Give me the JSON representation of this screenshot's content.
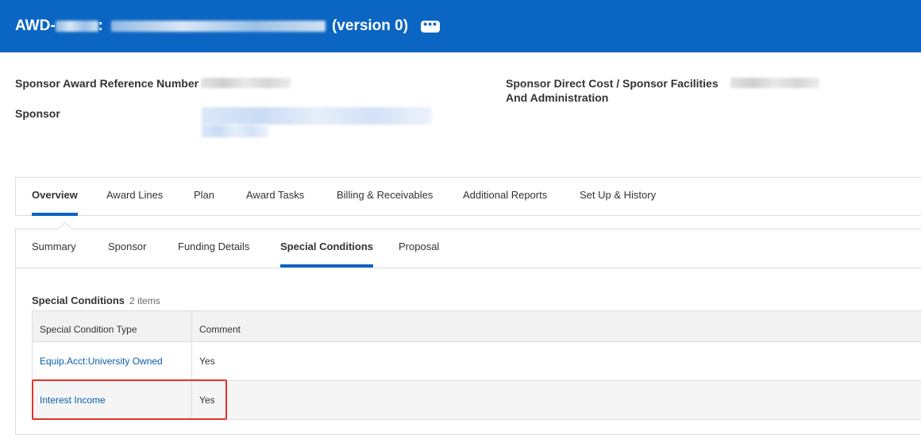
{
  "header": {
    "title_prefix": "AWD-",
    "title_separator": ":",
    "version": "(version 0)",
    "more_label": "•••",
    "bg_color": "#0b65c2"
  },
  "fields": {
    "sponsor_award_ref_label": "Sponsor Award Reference Number",
    "sponsor_label": "Sponsor",
    "direct_cost_label_line1": "Sponsor Direct Cost / Sponsor Facilities",
    "direct_cost_label_line2": "And Administration"
  },
  "tabs": [
    {
      "label": "Overview",
      "active": true
    },
    {
      "label": "Award Lines",
      "active": false
    },
    {
      "label": "Plan",
      "active": false
    },
    {
      "label": "Award Tasks",
      "active": false
    },
    {
      "label": "Billing & Receivables",
      "active": false
    },
    {
      "label": "Additional Reports",
      "active": false
    },
    {
      "label": "Set Up & History",
      "active": false
    }
  ],
  "sub_tabs": [
    {
      "label": "Summary",
      "active": false
    },
    {
      "label": "Sponsor",
      "active": false
    },
    {
      "label": "Funding Details",
      "active": false
    },
    {
      "label": "Special Conditions",
      "active": true
    },
    {
      "label": "Proposal",
      "active": false
    }
  ],
  "special_conditions": {
    "title": "Special Conditions",
    "count": "2 items",
    "columns": [
      "Special Condition Type",
      "Comment"
    ],
    "rows": [
      {
        "type": "Equip.Acct:University Owned",
        "comment": "Yes"
      },
      {
        "type": "Interest Income",
        "comment": "Yes"
      }
    ]
  },
  "accent_color": "#0b65c2",
  "highlight_color": "#e0342c"
}
